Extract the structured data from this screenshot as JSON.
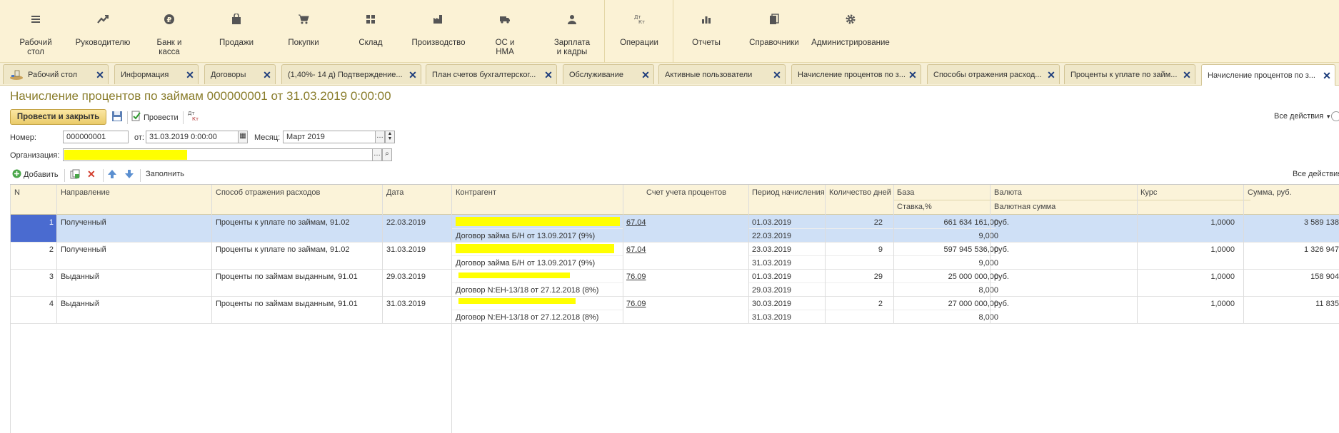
{
  "sections": [
    {
      "label": "Рабочий\nстол",
      "icon": "menu-icon"
    },
    {
      "label": "Руководителю",
      "icon": "trend-icon"
    },
    {
      "label": "Банк и\nкасса",
      "icon": "ruble-icon"
    },
    {
      "label": "Продажи",
      "icon": "bag-icon"
    },
    {
      "label": "Покупки",
      "icon": "cart-icon"
    },
    {
      "label": "Склад",
      "icon": "grid-icon"
    },
    {
      "label": "Производство",
      "icon": "factory-icon"
    },
    {
      "label": "ОС и\nНМА",
      "icon": "truck-icon"
    },
    {
      "label": "Зарплата\nи кадры",
      "icon": "person-icon"
    },
    {
      "label": "Операции",
      "icon": "dt-kt-icon"
    },
    {
      "label": "Отчеты",
      "icon": "bar-chart-icon"
    },
    {
      "label": "Справочники",
      "icon": "books-icon"
    },
    {
      "label": "Администрирование",
      "icon": "gear-icon"
    }
  ],
  "tabs": [
    "Рабочий стол",
    "Информация",
    "Договоры",
    "(1,40%- 14 д) Подтверждение...",
    "План счетов бухгалтерског...",
    "Обслуживание",
    "Активные пользователи",
    "Начисление процентов по з...",
    "Способы отражения расход...",
    "Проценты к уплате по займ...",
    "Начисление процентов по з..."
  ],
  "form": {
    "title": "Начисление процентов по займам 000000001 от 31.03.2019 0:00:00",
    "post_close": "Провести и закрыть",
    "post": "Провести",
    "dt_kt": "Дт Кт",
    "all_actions": "Все действия",
    "number_label": "Номер:",
    "number_value": "000000001",
    "from_label": "от:",
    "date_value": "31.03.2019  0:00:00",
    "month_label": "Месяц:",
    "month_value": "Март 2019",
    "org_label": "Организация:"
  },
  "table_toolbar": {
    "add": "Добавить",
    "fill": "Заполнить",
    "all_actions": "Все действия"
  },
  "columns": {
    "n": "N",
    "direction": "Направление",
    "method": "Способ отражения расходов",
    "date": "Дата",
    "counterparty": "Контрагент",
    "account": "Счет учета процентов",
    "period": "Период начисления",
    "days": "Количество дней",
    "base": "База",
    "rate": "Ставка,%",
    "currency": "Валюта",
    "cur_sum": "Валютная сумма",
    "course": "Курс",
    "sum": "Сумма, руб."
  },
  "rows": [
    {
      "n": "1",
      "direction": "Полученный",
      "method": "Проценты к уплате по займам, 91.02",
      "date": "22.03.2019",
      "contract": "Договор займа Б/Н от 13.09.2017 (9%)",
      "account": "67.04",
      "period_from": "01.03.2019",
      "period_to": "22.03.2019",
      "days": "22",
      "base": "661 634 161,00",
      "rate": "9,000",
      "currency": "руб.",
      "course": "1,0000",
      "sum": "3 589 138,"
    },
    {
      "n": "2",
      "direction": "Полученный",
      "method": "Проценты к уплате по займам, 91.02",
      "date": "31.03.2019",
      "contract": "Договор займа Б/Н от 13.09.2017 (9%)",
      "account": "67.04",
      "period_from": "23.03.2019",
      "period_to": "31.03.2019",
      "days": "9",
      "base": "597 945 536,00",
      "rate": "9,000",
      "currency": "руб.",
      "course": "1,0000",
      "sum": "1 326 947,"
    },
    {
      "n": "3",
      "direction": "Выданный",
      "method": "Проценты по займам выданным, 91.01",
      "date": "29.03.2019",
      "contract": "Договор N:ЕН-13/18 от 27.12.2018 (8%)",
      "account": "76.09",
      "period_from": "01.03.2019",
      "period_to": "29.03.2019",
      "days": "29",
      "base": "25 000 000,00",
      "rate": "8,000",
      "currency": "руб.",
      "course": "1,0000",
      "sum": "158 904,"
    },
    {
      "n": "4",
      "direction": "Выданный",
      "method": "Проценты по займам выданным, 91.01",
      "date": "31.03.2019",
      "contract": "Договор N:ЕН-13/18 от 27.12.2018 (8%)",
      "account": "76.09",
      "period_from": "30.03.2019",
      "period_to": "31.03.2019",
      "days": "2",
      "base": "27 000 000,00",
      "rate": "8,000",
      "currency": "руб.",
      "course": "1,0000",
      "sum": "11 835,"
    }
  ]
}
